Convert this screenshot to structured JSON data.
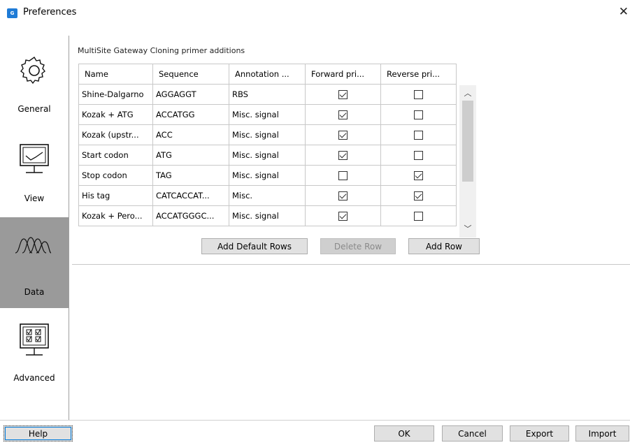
{
  "window": {
    "title": "Preferences",
    "app_icon_text": "G"
  },
  "sidebar": {
    "items": [
      {
        "label": "General",
        "icon": "gear-icon"
      },
      {
        "label": "View",
        "icon": "monitor-chart-icon"
      },
      {
        "label": "Data",
        "icon": "waves-icon",
        "active": true
      },
      {
        "label": "Advanced",
        "icon": "checklist-monitor-icon"
      }
    ]
  },
  "section": {
    "title": "MultiSite Gateway Cloning primer additions"
  },
  "table": {
    "columns": [
      "Name",
      "Sequence",
      "Annotation ...",
      "Forward pri...",
      "Reverse pri..."
    ],
    "rows": [
      {
        "name": "Shine-Dalgarno",
        "sequence": "AGGAGGT",
        "annotation": "RBS",
        "forward": true,
        "reverse": false
      },
      {
        "name": "Kozak + ATG",
        "sequence": "ACCATGG",
        "annotation": "Misc. signal",
        "forward": true,
        "reverse": false
      },
      {
        "name": "Kozak (upstr...",
        "sequence": "ACC",
        "annotation": "Misc. signal",
        "forward": true,
        "reverse": false
      },
      {
        "name": "Start codon",
        "sequence": "ATG",
        "annotation": "Misc. signal",
        "forward": true,
        "reverse": false
      },
      {
        "name": "Stop codon",
        "sequence": "TAG",
        "annotation": "Misc. signal",
        "forward": false,
        "reverse": true
      },
      {
        "name": "His tag",
        "sequence": "CATCACCAT...",
        "annotation": "Misc.",
        "forward": true,
        "reverse": true
      },
      {
        "name": "Kozak + Pero...",
        "sequence": "ACCATGGGC...",
        "annotation": "Misc. signal",
        "forward": true,
        "reverse": false
      }
    ]
  },
  "table_buttons": {
    "add_default": "Add Default Rows",
    "delete": "Delete Row",
    "add": "Add Row"
  },
  "footer": {
    "help": "Help",
    "ok": "OK",
    "cancel": "Cancel",
    "export": "Export",
    "import": "Import"
  },
  "colors": {
    "accent": "#1e7bd6",
    "sidebar_active": "#9a9a9a"
  }
}
